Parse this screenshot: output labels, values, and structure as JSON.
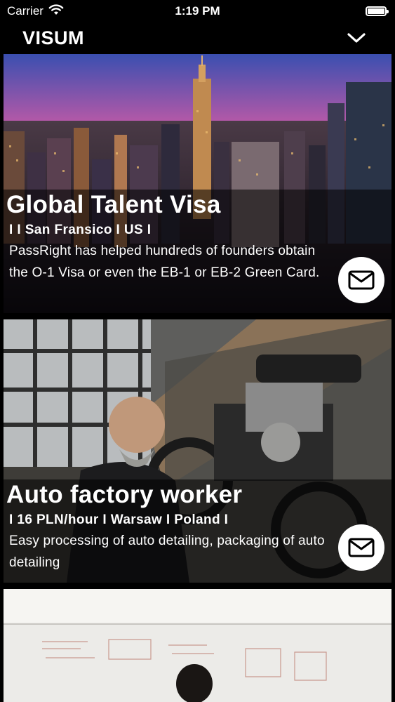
{
  "status_bar": {
    "carrier": "Carrier",
    "time": "1:19 PM"
  },
  "header": {
    "title": "VISUM"
  },
  "cards": [
    {
      "title": "Global Talent Visa",
      "meta": "I  I San Fransico I US I",
      "description": "PassRight has helped hundreds of founders obtain the O-1 Visa or even the EB-1 or EB-2 Green Card.",
      "image": "city-skyline-at-sunset"
    },
    {
      "title": "Auto factory worker",
      "meta": "I 16 PLN/hour I Warsaw I Poland I",
      "description": "Easy processing of auto detailing, packaging of auto detailing",
      "image": "mechanic-with-motorcycle"
    },
    {
      "title": "",
      "meta": "",
      "description": "",
      "image": "person-at-whiteboard"
    }
  ],
  "icons": {
    "wifi": "wifi-icon",
    "battery": "battery-icon",
    "menu": "chevron-down-icon",
    "contact": "mail-icon"
  }
}
